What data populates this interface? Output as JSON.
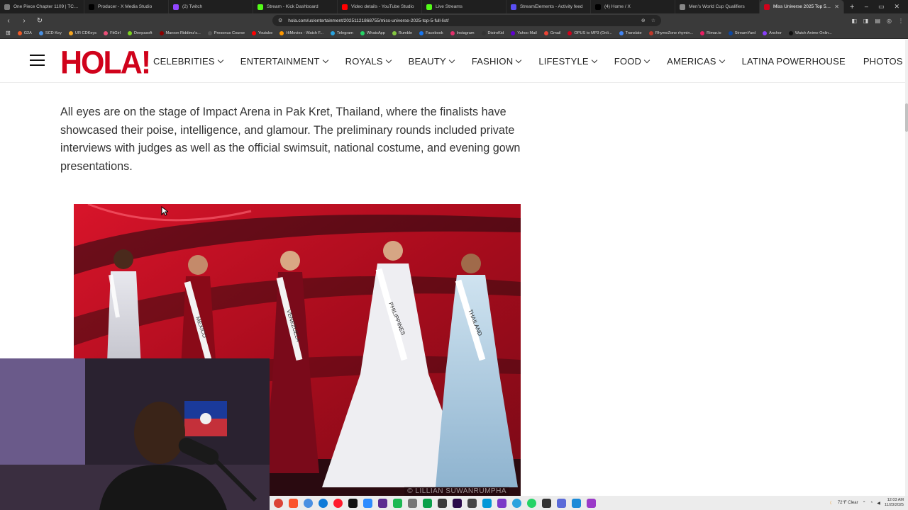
{
  "browser": {
    "tabs": [
      {
        "title": "One Piece Chapter 1109 | TCB Scans",
        "color": "#7a7a7a"
      },
      {
        "title": "Producer - X Media Studio",
        "color": "#000000"
      },
      {
        "title": "(2) Twitch",
        "color": "#9146ff"
      },
      {
        "title": "Stream - Kick Dashboard",
        "color": "#53fc18"
      },
      {
        "title": "Video details - YouTube Studio",
        "color": "#ff0000"
      },
      {
        "title": "Live Streams",
        "color": "#53fc18"
      },
      {
        "title": "StreamElements - Activity feed",
        "color": "#5a4ff3"
      },
      {
        "title": "(4) Home / X",
        "color": "#000000"
      },
      {
        "title": "Men's World Cup Qualifiers",
        "color": "#888888"
      },
      {
        "title": "Miss Universe 2025 Top 5 Full",
        "color": "#d0021b",
        "active": true
      }
    ],
    "new_tab": "+",
    "window_controls": [
      "–",
      "▭",
      "✕"
    ],
    "back": "‹",
    "forward": "›",
    "reload": "↻",
    "url": "hola.com/us/entertainment/20251121868755/miss-universe-2025-top-5-full-list/",
    "bookmarks": [
      {
        "label": "G2A",
        "color": "#f05a28"
      },
      {
        "label": "SCD Key",
        "color": "#4a90e2"
      },
      {
        "label": "UR CDKeys",
        "color": "#f5a623"
      },
      {
        "label": "FitGirl",
        "color": "#e94e77"
      },
      {
        "label": "Denpasoft",
        "color": "#7ed321"
      },
      {
        "label": "Maroon Riddimz's...",
        "color": "#8b0000"
      },
      {
        "label": "Presonus Course",
        "color": "#555555"
      },
      {
        "label": "Youtube",
        "color": "#ff0000"
      },
      {
        "label": "HiMovies - Watch F...",
        "color": "#ff9800"
      },
      {
        "label": "Telegram",
        "color": "#2aa3de"
      },
      {
        "label": "WhatsApp",
        "color": "#25d366"
      },
      {
        "label": "Rumble",
        "color": "#85c742"
      },
      {
        "label": "Facebook",
        "color": "#1877f2"
      },
      {
        "label": "Instagram",
        "color": "#e1306c"
      },
      {
        "label": "DistroKid",
        "color": "#333333"
      },
      {
        "label": "Yahoo Mail",
        "color": "#6001d2"
      },
      {
        "label": "Gmail",
        "color": "#ea4335"
      },
      {
        "label": "OPUS to MP3 (Onli...",
        "color": "#d0021b"
      },
      {
        "label": "Translate",
        "color": "#4285f4"
      },
      {
        "label": "RhymeZone rhymin...",
        "color": "#c0392b"
      },
      {
        "label": "Rimar.io",
        "color": "#e91e63"
      },
      {
        "label": "StreamYard",
        "color": "#0d47a1"
      },
      {
        "label": "Anchor",
        "color": "#8940fa"
      },
      {
        "label": "Watch Anime Onlin...",
        "color": "#111111"
      }
    ]
  },
  "site": {
    "logo": "HOLA!",
    "nav": [
      {
        "label": "CELEBRITIES",
        "dropdown": true
      },
      {
        "label": "ENTERTAINMENT",
        "dropdown": true
      },
      {
        "label": "ROYALS",
        "dropdown": true
      },
      {
        "label": "BEAUTY",
        "dropdown": true
      },
      {
        "label": "FASHION",
        "dropdown": true
      },
      {
        "label": "LIFESTYLE",
        "dropdown": true
      },
      {
        "label": "FOOD",
        "dropdown": true
      },
      {
        "label": "AMERICAS",
        "dropdown": true
      },
      {
        "label": "LATINA POWERHOUSE",
        "dropdown": false
      },
      {
        "label": "PHOTOS",
        "dropdown": false
      }
    ],
    "brand_color": "#d0021b"
  },
  "article": {
    "paragraph": "All eyes are on the stage of Impact Arena in Pak Kret, Thailand, where the finalists have showcased their poise, intelligence, and glamour. The preliminary rounds included private interviews with judges as well as the official swimsuit, national costume, and evening gown presentations.",
    "photo_credit": "© LILLIAN SUWANRUMPHA",
    "sash_texts": [
      "MEXICO",
      "VENEZUELA",
      "PHILIPPINES",
      "THAILAND"
    ]
  },
  "taskbar": {
    "weather": "72°F  Clear",
    "time": "12:03 AM",
    "date": "11/23/2025"
  }
}
